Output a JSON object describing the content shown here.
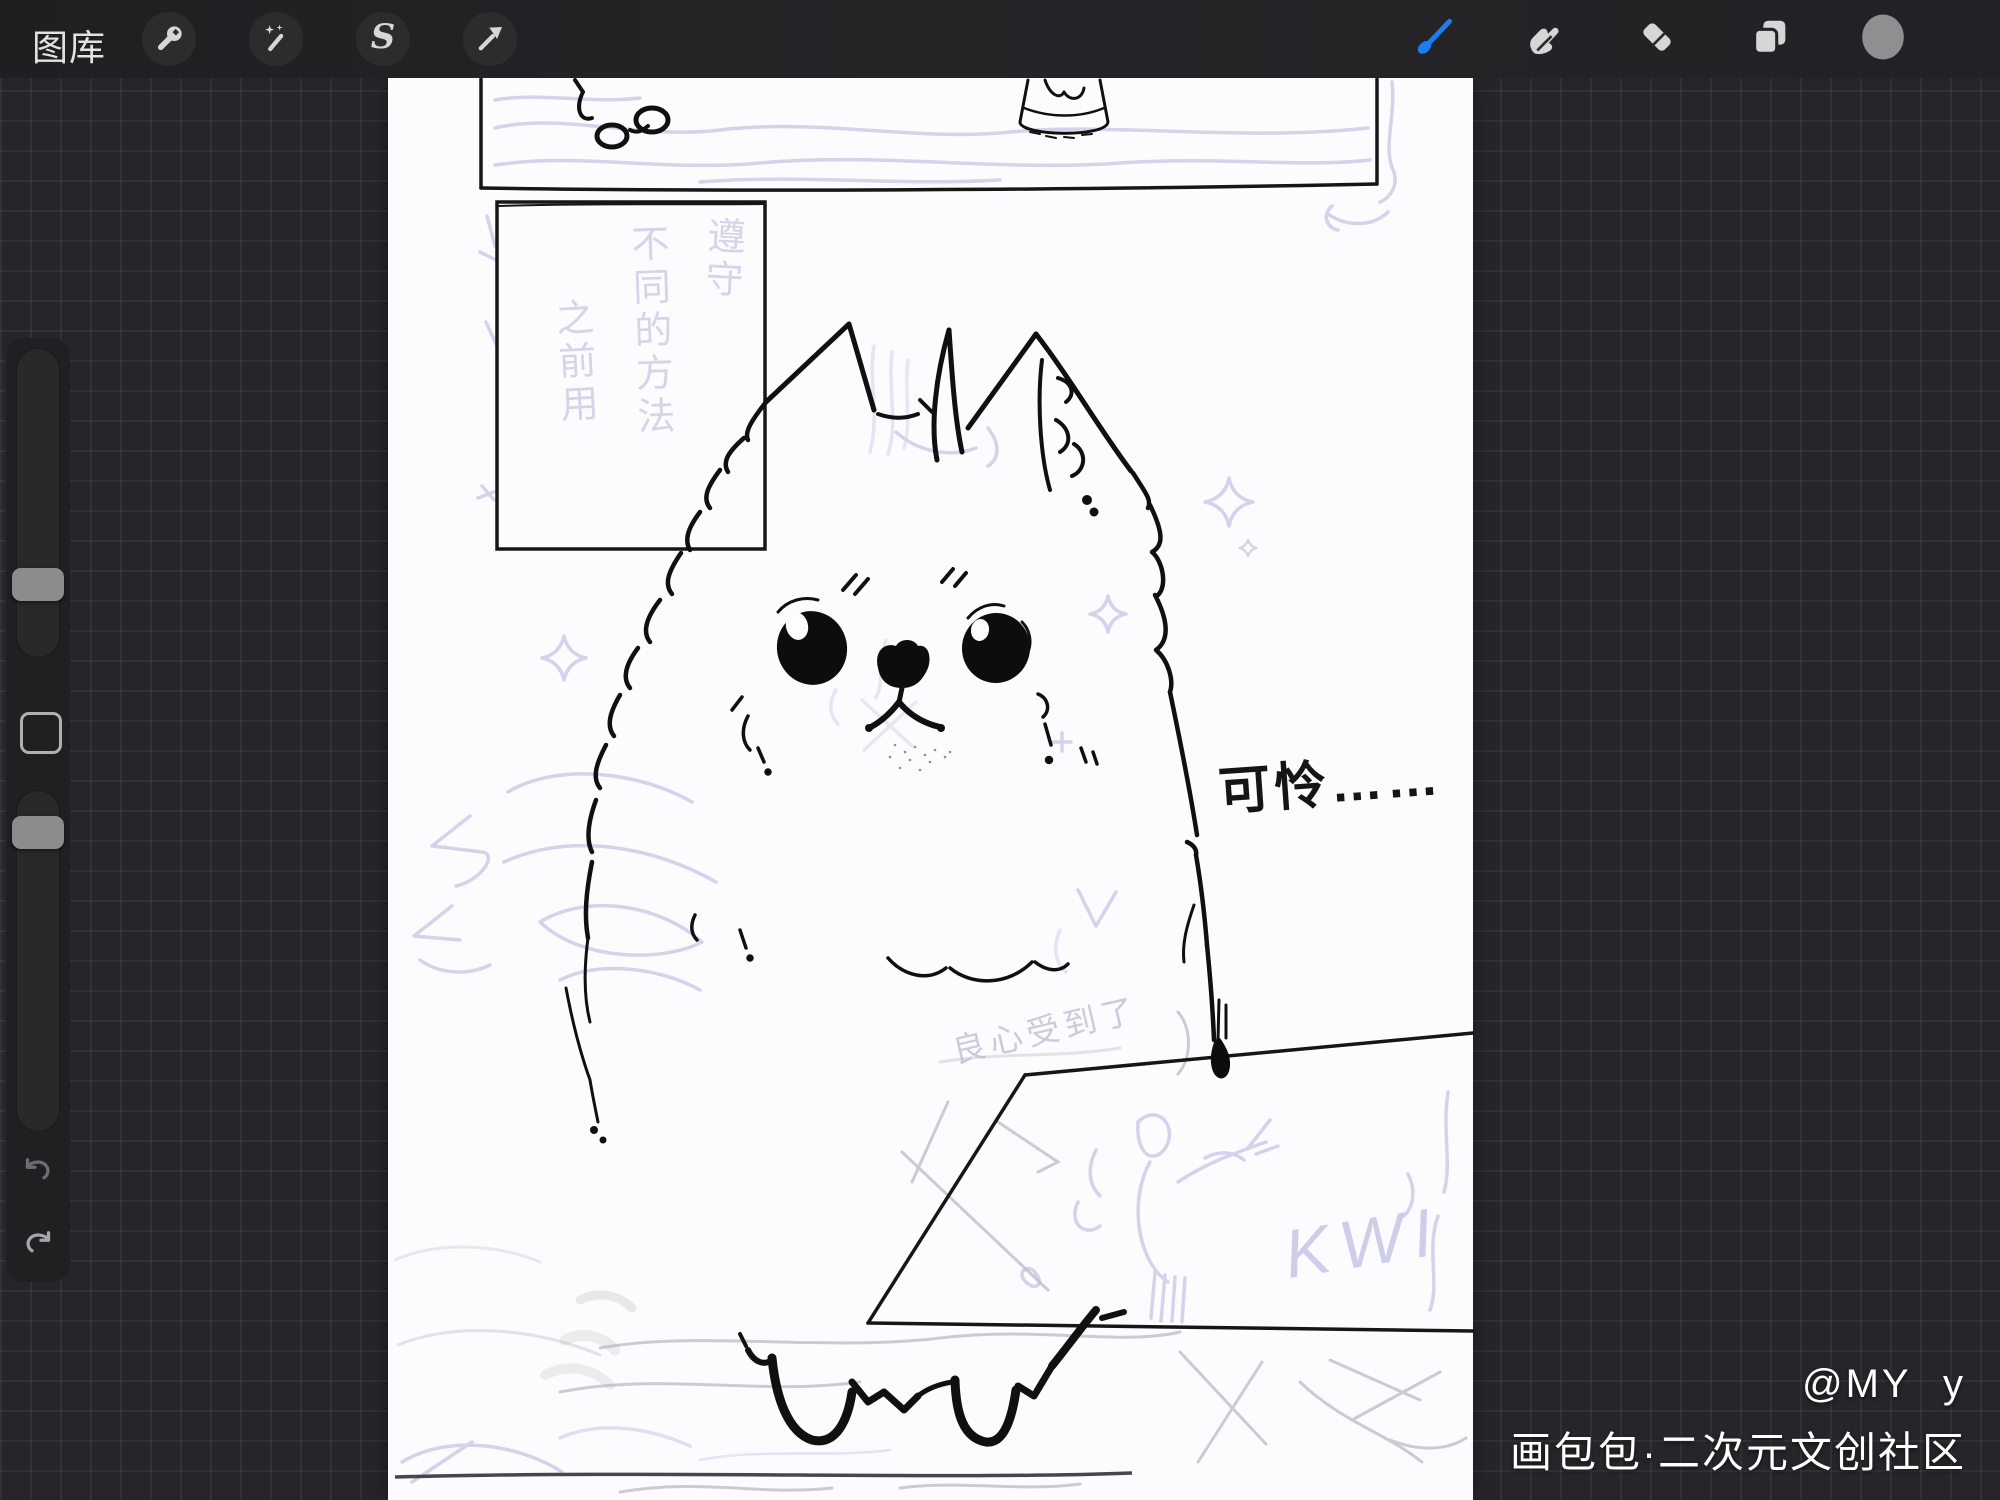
{
  "toolbar": {
    "gallery_label": "图库",
    "selection_letter": "S",
    "left_tools": [
      "actions-wrench",
      "adjustments-wand",
      "selection-s",
      "transform-arrow"
    ],
    "right_tools": [
      "paint-brush",
      "smudge",
      "erase",
      "layers",
      "color-swatch"
    ],
    "selected_tool": "paint-brush",
    "accent_color": "#1a7ef2",
    "icon_color": "#d6d6d8",
    "current_color_swatch": "#8f8f92"
  },
  "sidebar": {
    "controls": [
      "brush-size-slider",
      "modify-button",
      "opacity-slider",
      "undo",
      "redo"
    ]
  },
  "canvas": {
    "background_color": "#fcfcfe",
    "ink_color": "#101010",
    "sketch_lavender": "#cbcbe8",
    "speech_text": "可怜……",
    "kwi_text": "KWI",
    "note_text": "良心受到了",
    "panel_draft_columns": [
      "遵守",
      "不同的方法",
      "之前用"
    ]
  },
  "watermark": {
    "line1": "@MY y",
    "line2": "画包包·二次元文创社区"
  }
}
